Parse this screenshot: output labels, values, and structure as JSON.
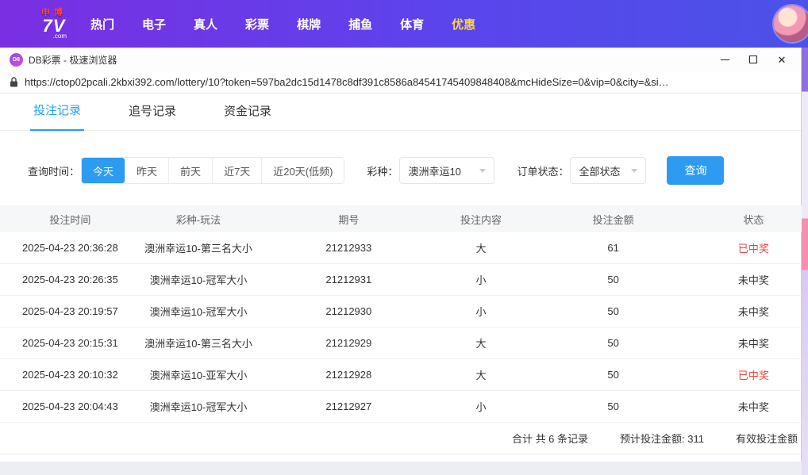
{
  "topnav": {
    "logo_top": "申博",
    "logo_main": "7V",
    "logo_suffix": ".com",
    "items": [
      "热门",
      "电子",
      "真人",
      "彩票",
      "棋牌",
      "捕鱼",
      "体育",
      "优惠"
    ],
    "highlight_color": "#f7d354"
  },
  "window": {
    "icon_text": "D8",
    "title": "DB彩票 - 极速浏览器",
    "close_glyph": "✕"
  },
  "address": {
    "url": "https://ctop02pcali.2kbxi392.com/lottery/10?token=597ba2dc15d1478c8df391c8586a84541745409848408&mcHideSize=0&vip=0&city=&si…"
  },
  "tabs": [
    {
      "label": "投注记录"
    },
    {
      "label": "追号记录"
    },
    {
      "label": "资金记录"
    }
  ],
  "filters": {
    "time_label": "查询时间：",
    "time_options": [
      "今天",
      "昨天",
      "前天",
      "近7天",
      "近20天(低频)"
    ],
    "active_time": "今天",
    "lottery_label": "彩种：",
    "lottery_value": "澳洲幸运10",
    "status_label": "订单状态：",
    "status_value": "全部状态",
    "search_button": "查询"
  },
  "table": {
    "headers": [
      "投注时间",
      "彩种-玩法",
      "期号",
      "投注内容",
      "投注金额",
      "状态"
    ],
    "win_status": "已中奖",
    "win_color": "#f2413b",
    "rows": [
      {
        "time": "2025-04-23 20:36:28",
        "play": "澳洲幸运10-第三名大小",
        "issue": "21212933",
        "content": "大",
        "amount": "61",
        "status": "已中奖"
      },
      {
        "time": "2025-04-23 20:26:35",
        "play": "澳洲幸运10-冠军大小",
        "issue": "21212931",
        "content": "小",
        "amount": "50",
        "status": "未中奖"
      },
      {
        "time": "2025-04-23 20:19:57",
        "play": "澳洲幸运10-冠军大小",
        "issue": "21212930",
        "content": "小",
        "amount": "50",
        "status": "未中奖"
      },
      {
        "time": "2025-04-23 20:15:31",
        "play": "澳洲幸运10-第三名大小",
        "issue": "21212929",
        "content": "大",
        "amount": "50",
        "status": "未中奖"
      },
      {
        "time": "2025-04-23 20:10:32",
        "play": "澳洲幸运10-亚军大小",
        "issue": "21212928",
        "content": "大",
        "amount": "50",
        "status": "已中奖"
      },
      {
        "time": "2025-04-23 20:04:43",
        "play": "澳洲幸运10-冠军大小",
        "issue": "21212927",
        "content": "小",
        "amount": "50",
        "status": "未中奖"
      }
    ]
  },
  "summary": {
    "total": "合计 共 6 条记录",
    "expected": "预计投注金额: 311",
    "valid": "有效投注金额"
  }
}
